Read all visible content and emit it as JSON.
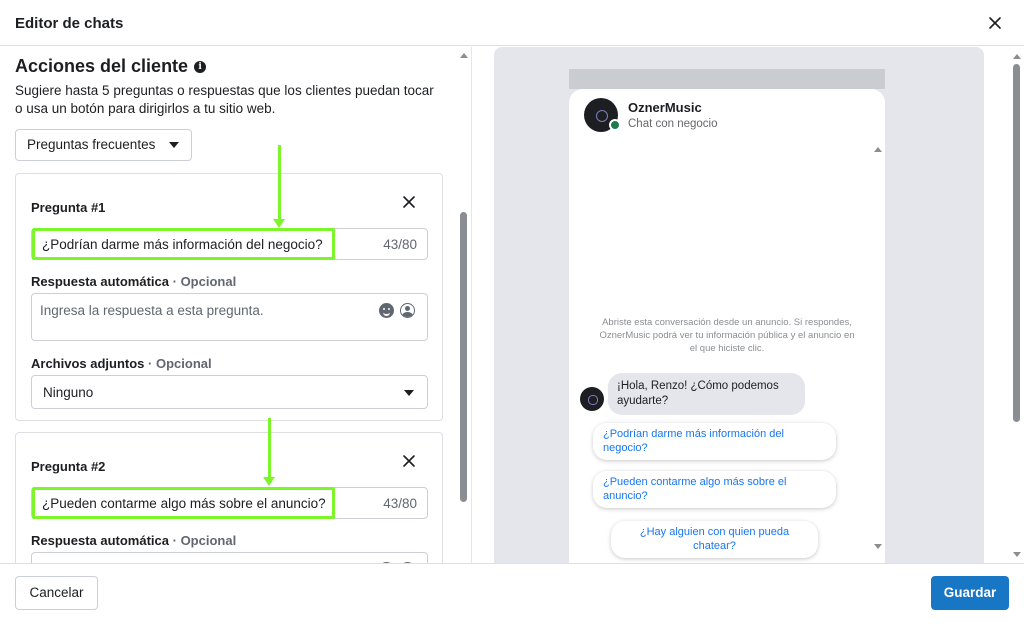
{
  "dialog": {
    "title": "Editor de chats"
  },
  "section": {
    "title": "Acciones del cliente",
    "info_icon": "i",
    "description": "Sugiere hasta 5 preguntas o respuestas que los clientes puedan tocar o usa un botón para dirigirlos a tu sitio web.",
    "dropdown_value": "Preguntas frecuentes"
  },
  "questions": [
    {
      "label": "Pregunta #1",
      "value": "¿Podrían darme más información del negocio?",
      "count": "43/80",
      "reply_label": "Respuesta automática",
      "optional": "· Opcional",
      "reply_placeholder": "Ingresa la respuesta a esta pregunta.",
      "attachments_label": "Archivos adjuntos",
      "attachments_value": "Ninguno"
    },
    {
      "label": "Pregunta #2",
      "value": "¿Pueden contarme algo más sobre el anuncio?",
      "count": "43/80",
      "reply_label": "Respuesta automática",
      "optional": "· Opcional"
    }
  ],
  "preview": {
    "page_name": "OznerMusic",
    "page_subtitle": "Chat con negocio",
    "notice": "Abriste esta conversación desde un anuncio. Si respondes, OznerMusic podrá ver tu información pública y el anuncio en el que hiciste clic.",
    "greeting": "¡Hola, Renzo! ¿Cómo podemos ayudarte?",
    "quick_replies": [
      "¿Podrían darme más información del negocio?",
      "¿Pueden contarme algo más sobre el anuncio?",
      "¿Hay alguien con quien pueda chatear?"
    ]
  },
  "footer": {
    "cancel_label": "Cancelar",
    "save_label": "Guardar"
  },
  "colors": {
    "primary_button": "#1877c5",
    "highlight": "#7cf52b",
    "link": "#1877f2"
  }
}
